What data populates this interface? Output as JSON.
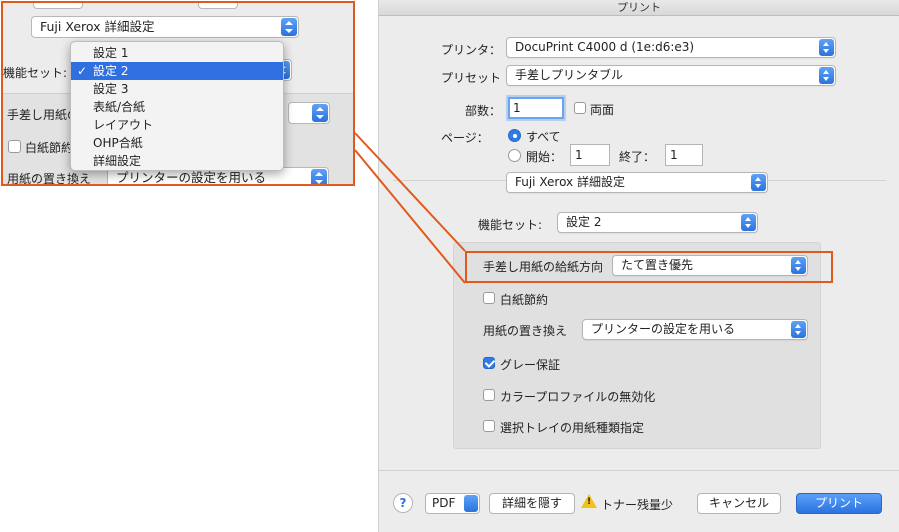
{
  "inset": {
    "preset_popup": "Fuji Xerox 詳細設定",
    "feature_set_label": "機能セット:",
    "feature_set_value": "設定 2",
    "tray_label": "手差し用紙の",
    "econ_label": "白紙節約",
    "replace_label": "用紙の置き換え",
    "replace_value": "プリンターの設定を用いる",
    "menu": {
      "items": [
        "設定 1",
        "設定 2",
        "設定 3",
        "表紙/合紙",
        "レイアウト",
        "OHP合紙",
        "詳細設定"
      ],
      "selected_index": 1,
      "check_glyph": "✓"
    }
  },
  "dialog": {
    "title": "プリント",
    "printer_label": "プリンタ：",
    "printer_value": "DocuPrint C4000 d (1e:d6:e3)",
    "preset_label": "プリセット",
    "preset_value": "手差しプリンタブル",
    "copies_label": "部数：",
    "copies_value": "1",
    "duplex_label": "両面",
    "pages_label": "ページ：",
    "pages_all": "すべて",
    "pages_from_label": "開始：",
    "pages_from_value": "1",
    "pages_to_label": "終了：",
    "pages_to_value": "1",
    "section_popup": "Fuji Xerox 詳細設定",
    "feature_set_label": "機能セット:",
    "feature_set_value": "設定 2",
    "tray_label": "手差し用紙の給紙方向",
    "tray_value": "たて置き優先",
    "econ_label": "白紙節約",
    "replace_label": "用紙の置き換え",
    "replace_value": "プリンターの設定を用いる",
    "gray_label": "グレー保証",
    "gray_checked": true,
    "profile_label": "カラープロファイルの無効化",
    "tray_select_label": "選択トレイの用紙種類指定",
    "help_label": "?",
    "pdf_label": "PDF",
    "hide_details_label": "詳細を隠す",
    "toner_warning": "トナー残量少",
    "cancel_label": "キャンセル",
    "print_label": "プリント"
  },
  "colors": {
    "accent": "#2f6fe0",
    "callout": "#e05a1e",
    "warning": "#f1c21b"
  }
}
